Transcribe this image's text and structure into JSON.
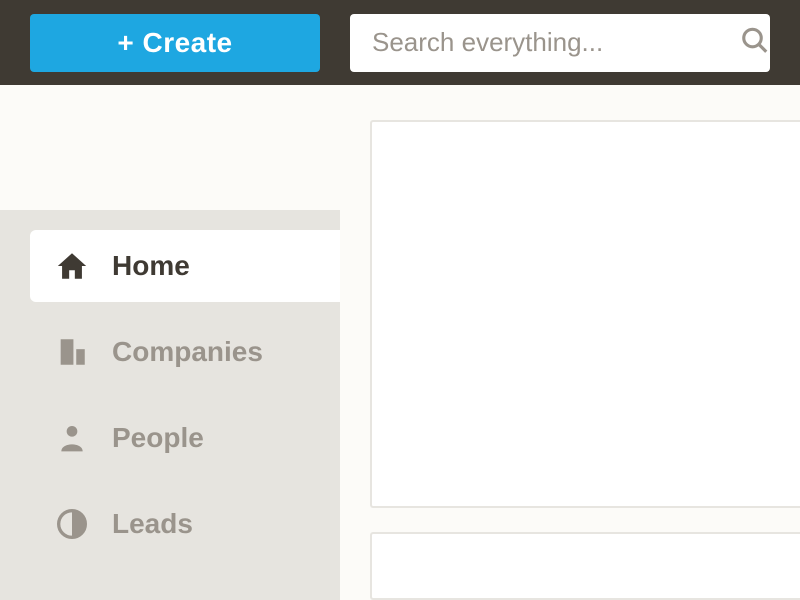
{
  "header": {
    "create_label": "+ Create",
    "search_placeholder": "Search everything..."
  },
  "sidebar": {
    "items": [
      {
        "label": "Home",
        "icon": "home-icon",
        "active": true
      },
      {
        "label": "Companies",
        "icon": "companies-icon",
        "active": false
      },
      {
        "label": "People",
        "icon": "people-icon",
        "active": false
      },
      {
        "label": "Leads",
        "icon": "leads-icon",
        "active": false
      }
    ]
  },
  "colors": {
    "accent": "#1ea7e1",
    "topbar": "#3f3a33",
    "muted": "#9a948c",
    "panel": "#e6e4df"
  }
}
